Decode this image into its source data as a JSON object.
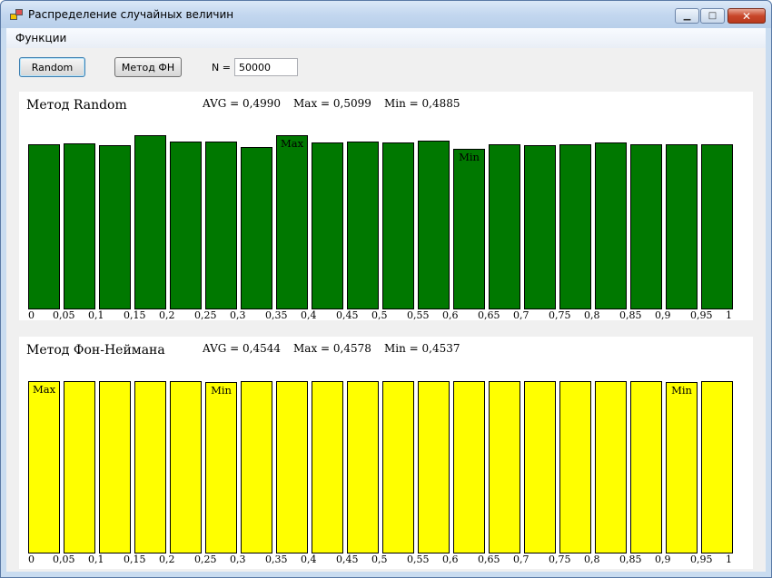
{
  "window": {
    "title": "Распределение случайных величин",
    "controls": {
      "minimize": "▁",
      "maximize": "□",
      "close": "✕"
    }
  },
  "menu": {
    "items": [
      "Функции"
    ]
  },
  "toolbar": {
    "random_button": "Random",
    "fn_button": "Метод ФН",
    "n_label": "N =",
    "n_value": "50000"
  },
  "chart_data": [
    {
      "type": "bar",
      "title": "Метод Random",
      "bar_color": "#007800",
      "stats": {
        "avg": "AVG = 0,4990",
        "max": "Max = 0,5099",
        "min": "Min = 0,4885"
      },
      "x_ticks": [
        "0",
        "0,05",
        "0,1",
        "0,15",
        "0,2",
        "0,25",
        "0,3",
        "0,35",
        "0,4",
        "0,45",
        "0,5",
        "0,55",
        "0,6",
        "0,65",
        "0,7",
        "0,75",
        "0,8",
        "0,85",
        "0,9",
        "0,95",
        "1"
      ],
      "values": [
        2502,
        2520,
        2496,
        2642,
        2539,
        2547,
        2463,
        2642,
        2536,
        2551,
        2532,
        2555,
        2442,
        2510,
        2490,
        2508,
        2532,
        2508,
        2501,
        2502
      ],
      "bar_labels": [
        {
          "index": 7,
          "text": "Max"
        },
        {
          "index": 12,
          "text": "Min"
        }
      ]
    },
    {
      "type": "bar",
      "title": "Метод Фон-Неймана",
      "bar_color": "#ffff00",
      "stats": {
        "avg": "AVG = 0,4544",
        "max": "Max = 0,4578",
        "min": "Min = 0,4537"
      },
      "x_ticks": [
        "0",
        "0,05",
        "0,1",
        "0,15",
        "0,2",
        "0,25",
        "0,3",
        "0,35",
        "0,4",
        "0,45",
        "0,5",
        "0,55",
        "0,6",
        "0,65",
        "0,7",
        "0,75",
        "0,8",
        "0,85",
        "0,9",
        "0,95",
        "1"
      ],
      "values": [
        2516,
        2512,
        2512,
        2518,
        2513,
        2508,
        2512,
        2518,
        2512,
        2512,
        2512,
        2518,
        2512,
        2512,
        2512,
        2512,
        2518,
        2512,
        2508,
        2512
      ],
      "bar_labels": [
        {
          "index": 0,
          "text": "Max"
        },
        {
          "index": 5,
          "text": "Min"
        },
        {
          "index": 18,
          "text": "Min"
        }
      ]
    }
  ]
}
